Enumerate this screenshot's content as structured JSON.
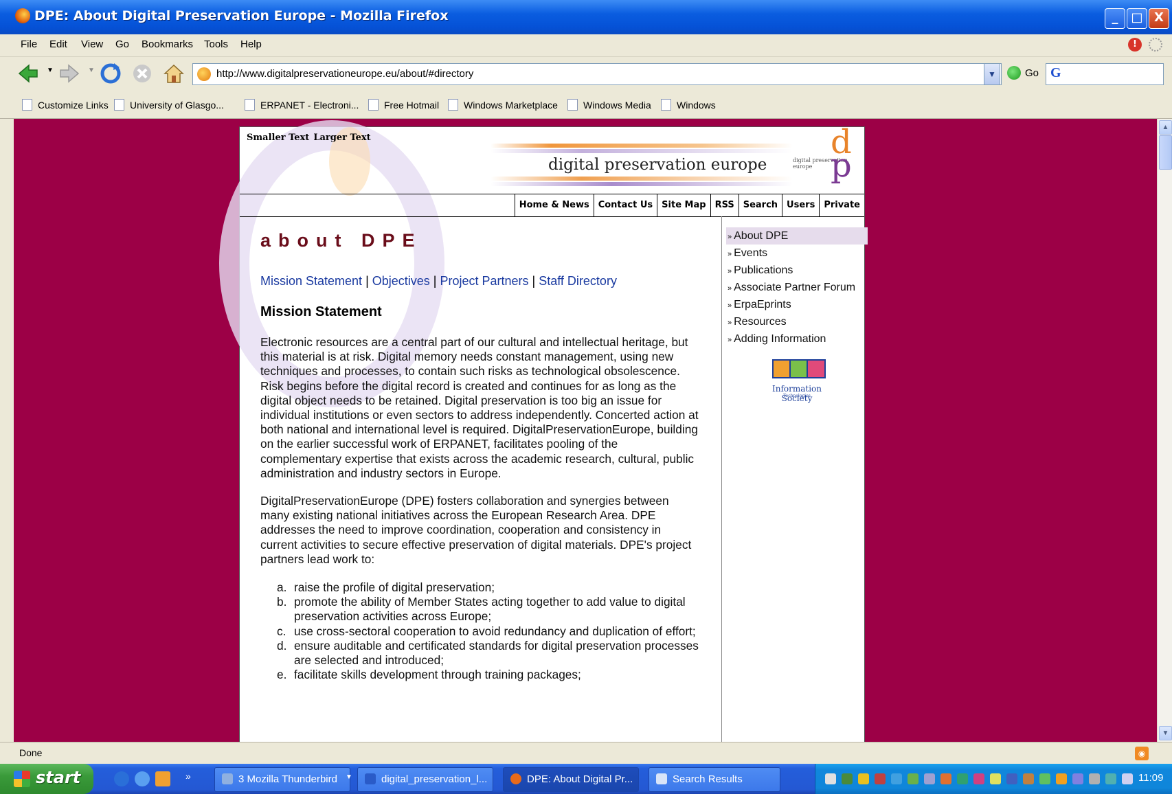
{
  "window": {
    "title": "DPE: About Digital Preservation Europe - Mozilla Firefox",
    "buttons": {
      "minimize": "_",
      "maximize": "□",
      "close": "X"
    }
  },
  "menu": [
    "File",
    "Edit",
    "View",
    "Go",
    "Bookmarks",
    "Tools",
    "Help"
  ],
  "navbar": {
    "url": "http://www.digitalpreservationeurope.eu/about/#directory",
    "go_label": "Go",
    "search_engine_glyph": "G"
  },
  "bookmarks": [
    "Customize Links",
    "University of Glasgo...",
    "ERPANET - Electroni...",
    "Free Hotmail",
    "Windows Marketplace",
    "Windows Media",
    "Windows"
  ],
  "page": {
    "text_size": {
      "smaller": "Smaller Text",
      "larger": "Larger Text"
    },
    "banner_title": "digital preservation europe",
    "logo_small_text": "digital preservation europe",
    "logo_letters": {
      "d": "d",
      "p": "p"
    },
    "nav_tabs": [
      "Home & News",
      "Contact Us",
      "Site Map",
      "RSS",
      "Search",
      "Users",
      "Private"
    ],
    "heading": "about DPE",
    "sublinks": {
      "mission": "Mission Statement",
      "objectives": "Objectives",
      "partners": "Project Partners",
      "staff": "Staff Directory",
      "sep": " | "
    },
    "mission_heading": "Mission Statement",
    "para1": "Electronic resources are a central part of our cultural and intellectual heritage, but this material is at risk. Digital memory needs constant management, using new techniques and processes, to contain such risks as technological obsolescence. Risk begins before the digital record is created and continues for as long as the digital object needs to be retained. Digital preservation is too big an issue for individual institutions or even sectors to address independently. Concerted action at both national and international level is required. DigitalPreservationEurope, building on the earlier successful work of ERPANET, facilitates pooling of the complementary expertise that exists across the academic research, cultural, public administration and industry sectors in Europe.",
    "para2": "DigitalPreservationEurope (DPE) fosters collaboration and synergies between many existing national initiatives across the European Research Area. DPE addresses the need to improve coordination, cooperation and consistency in current activities to secure effective preservation of digital materials. DPE's project partners lead work to:",
    "list": [
      {
        "marker": "a.",
        "text": "raise the profile of digital preservation;"
      },
      {
        "marker": "b.",
        "text": "promote the ability of Member States acting together to add value to digital preservation activities across Europe;"
      },
      {
        "marker": "c.",
        "text": "use cross-sectoral cooperation to avoid redundancy and duplication of effort;"
      },
      {
        "marker": "d.",
        "text": "ensure auditable and certificated standards for digital preservation processes are selected and introduced;"
      },
      {
        "marker": "e.",
        "text": "facilitate skills development through training packages;"
      }
    ],
    "sidebar": [
      "About DPE",
      "Events",
      "Publications",
      "Associate Partner Forum",
      "ErpaEprints",
      "Resources",
      "Adding Information"
    ],
    "ist_logo": {
      "title": "Information Society",
      "sub": "Technologies"
    }
  },
  "status": {
    "text": "Done"
  },
  "taskbar": {
    "start": "start",
    "tasks": [
      "3 Mozilla Thunderbird",
      "digital_preservation_l...",
      "DPE: About Digital Pr...",
      "Search Results"
    ],
    "clock": "11:09"
  },
  "colors": {
    "page_bg": "#9c0046",
    "heading": "#6a0d1a",
    "link": "#1a3aa0",
    "taskbar": "#245edb"
  }
}
